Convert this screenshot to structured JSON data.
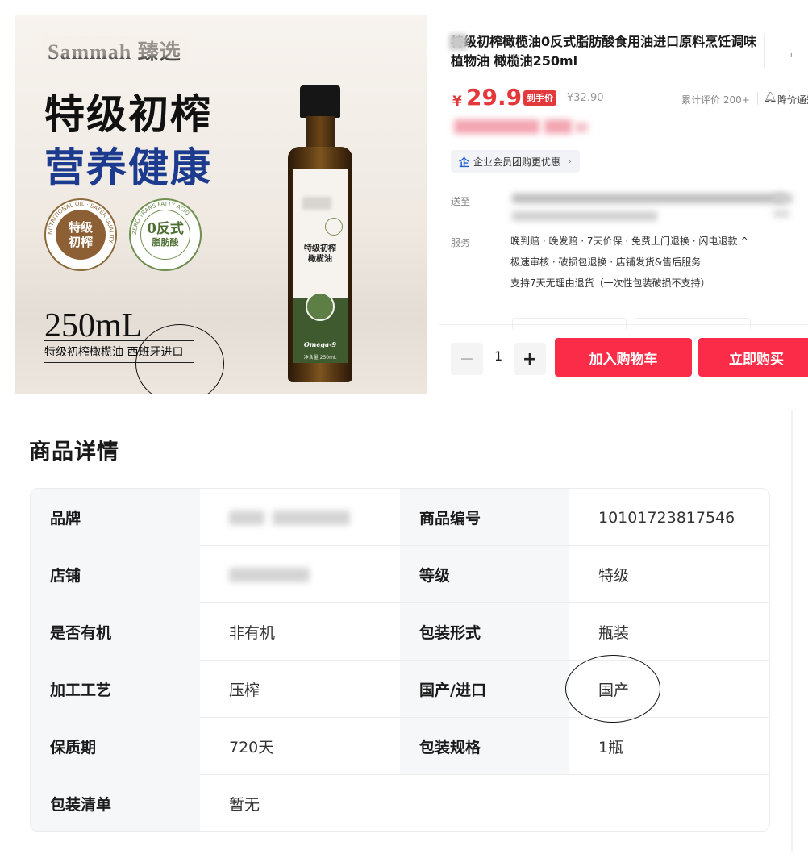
{
  "banner": {
    "brand": "Sammah 臻选",
    "headline1": "特级初榨",
    "headline2": "营养健康",
    "seal_left_lines": [
      "特级",
      "初榨"
    ],
    "seal_left_ring": "NUTRITIONAL OIL · SAFER QUALITY",
    "seal_right_big": "0反式",
    "seal_right_small": "脂肪酸",
    "seal_right_ring": "ZERO TRANS FATTY ACID",
    "volume": "250mL",
    "subtitle": "特级初榨橄榄油  西班牙进口",
    "bottle_label_name": "特级初榨\n橄榄油",
    "bottle_label_omega": "Omega-9",
    "bottle_label_net": "净含量 250mL"
  },
  "product": {
    "title": "特级初榨橄榄油0反式脂肪酸食用油进口原料烹饪调味植物油 橄榄油250ml",
    "price_symbol": "¥",
    "price": "29.9",
    "price_tag": "到手价",
    "original_price": "¥32.90",
    "reviews": "累计评价 200+",
    "price_drop": "降价通知",
    "enterprise_label": "企业会员团购更优惠",
    "ship_label": "送至",
    "service_label": "服务",
    "services_line1": "晚到赔 · 晚发赔 · 7天价保 · 免费上门退换 · 闪电退款 ^",
    "services_line2": "极速审核 · 破损包退换 · 店铺发货&售后服务",
    "services_line3": "支持7天无理由退货（一次性包装破损不支持）",
    "quantity": "1",
    "minus": "−",
    "plus": "+",
    "add_cart": "加入购物车",
    "buy_now": "立即购买"
  },
  "details": {
    "heading": "商品详情",
    "rows": [
      {
        "k1": "品牌",
        "v1": "",
        "k2": "商品编号",
        "v2": "10101723817546"
      },
      {
        "k1": "店铺",
        "v1": "",
        "k2": "等级",
        "v2": "特级"
      },
      {
        "k1": "是否有机",
        "v1": "非有机",
        "k2": "包装形式",
        "v2": "瓶装"
      },
      {
        "k1": "加工工艺",
        "v1": "压榨",
        "k2": "国产/进口",
        "v2": "国产"
      },
      {
        "k1": "保质期",
        "v1": "720天",
        "k2": "包装规格",
        "v2": "1瓶"
      },
      {
        "k1": "包装清单",
        "v1": "暂无"
      }
    ]
  },
  "colors": {
    "accent_red": "#e4393c",
    "button_red": "#fa2c47",
    "headline_blue": "#1c3b8f"
  }
}
